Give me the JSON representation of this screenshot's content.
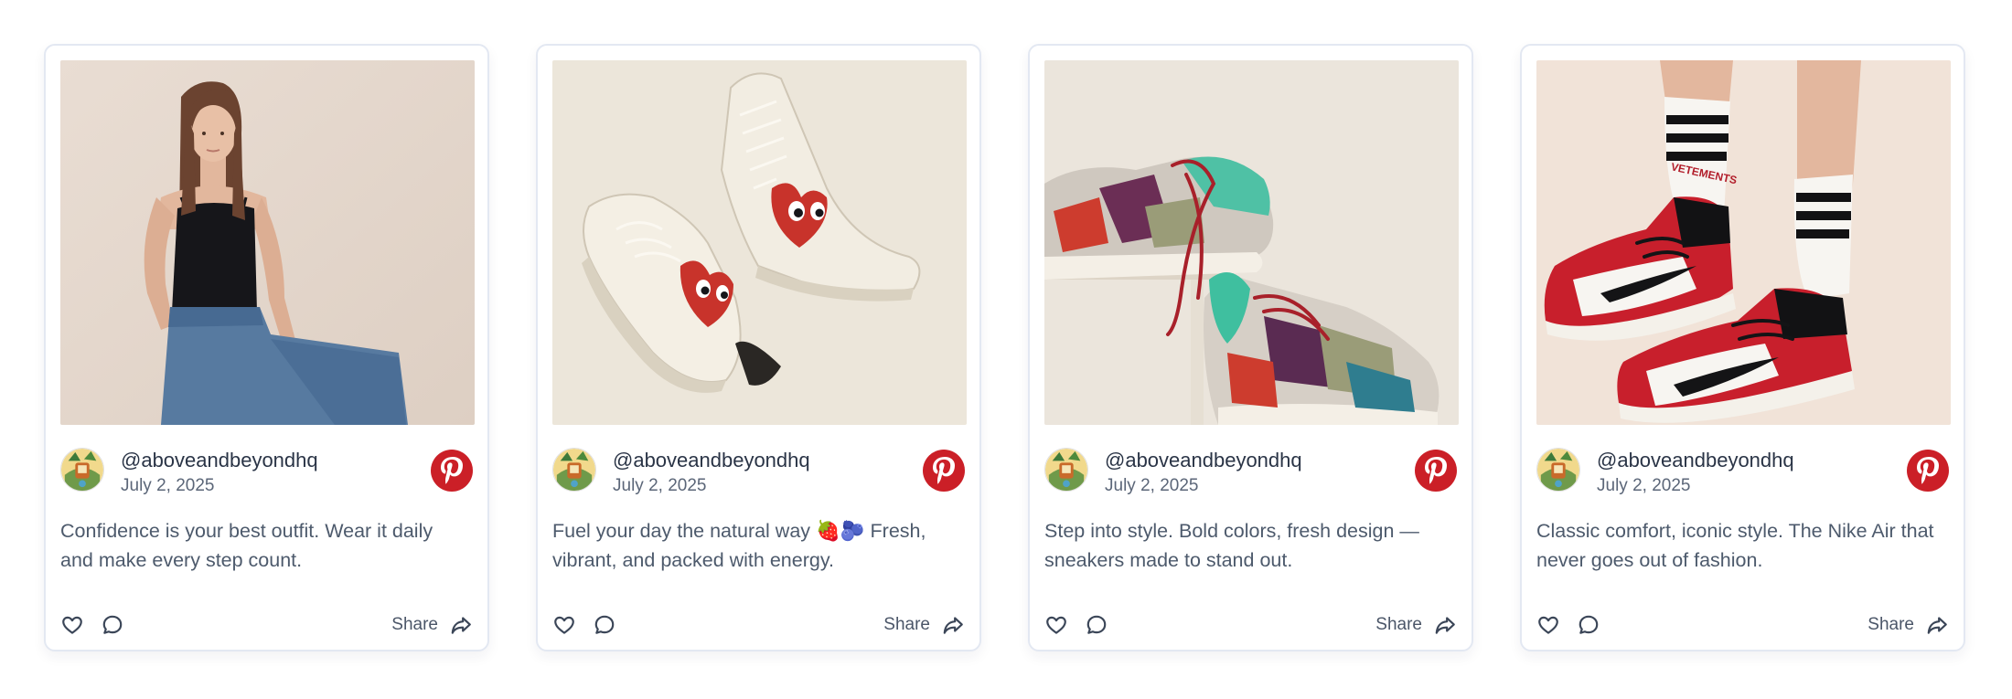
{
  "posts": [
    {
      "handle": "@aboveandbeyondhq",
      "date": "July 2, 2025",
      "caption": "Confidence is your best outfit. Wear it daily and make every step count.",
      "share_label": "Share",
      "photo": "woman-in-black-tank-top-and-jeans"
    },
    {
      "handle": "@aboveandbeyondhq",
      "date": "July 2, 2025",
      "caption": "Fuel your day the natural way 🍓🫐 Fresh, vibrant, and packed with energy.",
      "share_label": "Share",
      "photo": "cream-canvas-high-top-sneakers-with-red-heart-logo"
    },
    {
      "handle": "@aboveandbeyondhq",
      "date": "July 2, 2025",
      "caption": "Step into style. Bold colors, fresh design — sneakers made to stand out.",
      "share_label": "Share",
      "photo": "multicolor-chunky-sneakers-on-stand"
    },
    {
      "handle": "@aboveandbeyondhq",
      "date": "July 2, 2025",
      "caption": "Classic comfort, iconic style. The Nike Air that never goes out of fashion.",
      "share_label": "Share",
      "photo": "red-black-white-high-top-sneakers-with-striped-socks",
      "sock_text": "VETEMENTS"
    }
  ],
  "icons": {
    "network": "pinterest-icon",
    "like": "heart-icon",
    "comment": "comment-icon",
    "share": "share-arrow-icon"
  },
  "colors": {
    "pinterest_red": "#cb1f27",
    "card_border": "#e3e8f2",
    "text_primary": "#2a3446",
    "text_secondary": "#5b6678"
  }
}
